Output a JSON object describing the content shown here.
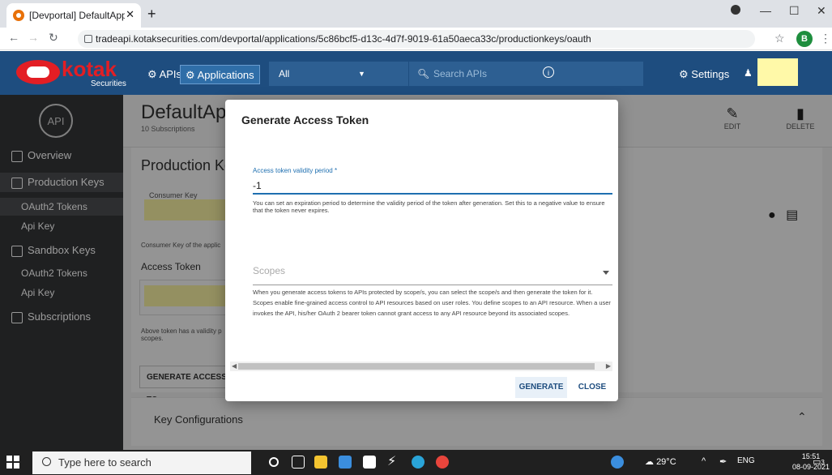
{
  "browser": {
    "tab_title": "[Devportal] DefaultApplication A",
    "tab_close": "✕",
    "new_tab": "+",
    "url": "tradeapi.kotaksecurities.com/devportal/applications/5c86bcf5-d13c-4d7f-9019-61a50aeca33c/productionkeys/oauth",
    "profile_initial": "B",
    "window_controls": [
      "—",
      "☐",
      "✕"
    ]
  },
  "header": {
    "logo_text": "kotak",
    "logo_sub": "Securities",
    "nav_apis": "APIs",
    "nav_applications": "Applications",
    "filter_selected": "All",
    "search_placeholder": "Search APIs",
    "settings": "Settings"
  },
  "sidebar": {
    "logo": "API",
    "items": [
      {
        "label": "Overview"
      },
      {
        "label": "Production Keys"
      },
      {
        "label": "OAuth2 Tokens"
      },
      {
        "label": "Api Key"
      },
      {
        "label": "Sandbox Keys"
      },
      {
        "label": "OAuth2 Tokens"
      },
      {
        "label": "Api Key"
      },
      {
        "label": "Subscriptions"
      }
    ]
  },
  "page": {
    "app_title": "DefaultAp",
    "subscriptions": "10 Subscriptions",
    "edit": "EDIT",
    "delete": "DELETE",
    "section_title": "Production Ke",
    "consumer_key_label": "Consumer Key",
    "consumer_key_help": "Consumer Key of the applic",
    "access_token_label": "Access Token",
    "access_token_help": "Above token has a validity p scopes.",
    "generate_button": "GENERATE ACCESS TO",
    "key_configurations": "Key Configurations"
  },
  "modal": {
    "title": "Generate Access Token",
    "validity_label": "Access token validity period *",
    "validity_value": "-1",
    "validity_help": "You can set an expiration period to determine the validity period of the token after generation. Set this to a negative value to ensure that the token never expires.",
    "scopes_placeholder": "Scopes",
    "scopes_help": "When you generate access tokens to APIs protected by scope/s, you can select the scope/s and then generate the token for it. Scopes enable fine-grained access control to API resources based on user roles. You define scopes to an API resource. When a user invokes the API, his/her OAuth 2 bearer token cannot grant access to any API resource beyond its associated scopes.",
    "generate": "GENERATE",
    "close": "CLOSE"
  },
  "taskbar": {
    "search_placeholder": "Type here to search",
    "temperature": "29°C",
    "language": "ENG",
    "time": "15:51",
    "date": "08-09-2021",
    "notification_count": "3"
  }
}
